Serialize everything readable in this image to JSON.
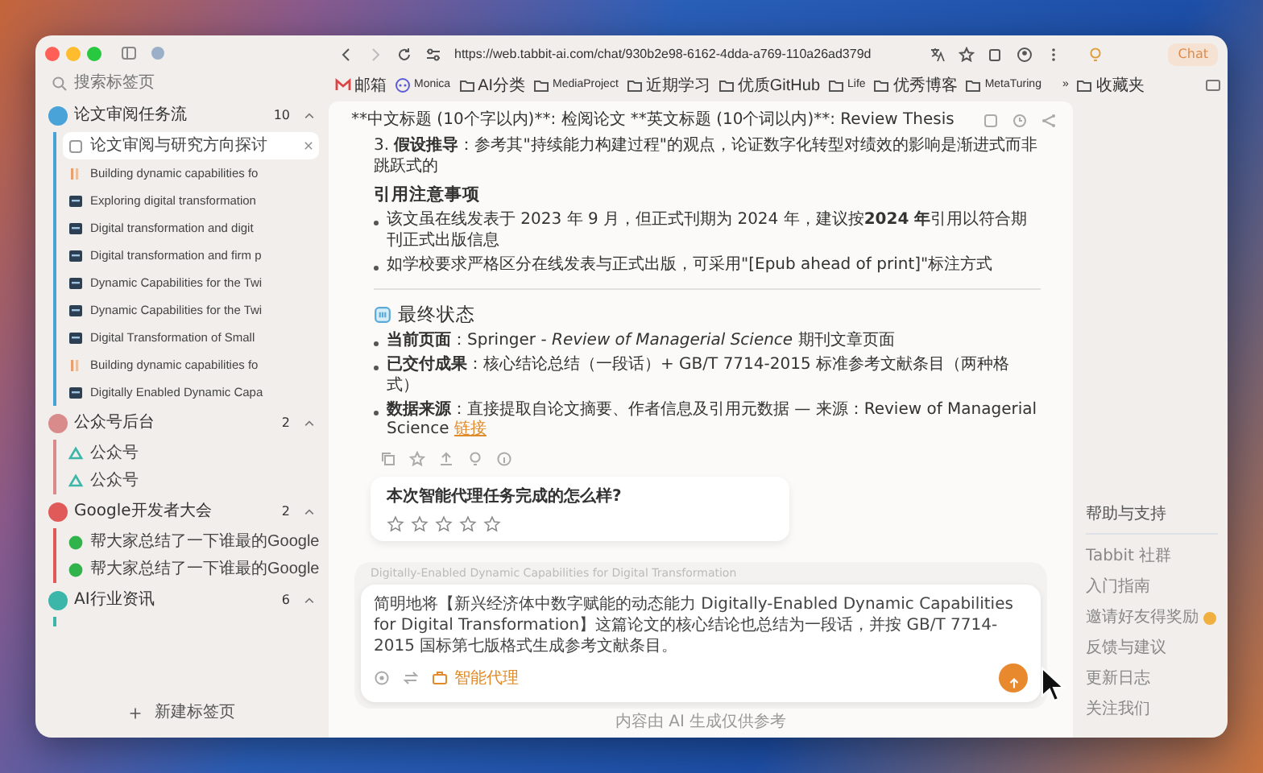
{
  "browser": {
    "url": "https://web.tabbit-ai.com/chat/930b2e98-6162-4dda-a769-110a26ad379d",
    "chat_button": "Chat"
  },
  "bookmarks": [
    {
      "label": "邮箱",
      "kind": "mail"
    },
    {
      "label": "Monica",
      "kind": "app"
    },
    {
      "label": "AI分类",
      "kind": "folder"
    },
    {
      "label": "MediaProject",
      "kind": "folder"
    },
    {
      "label": "近期学习",
      "kind": "folder"
    },
    {
      "label": "优质GitHub",
      "kind": "folder"
    },
    {
      "label": "Life",
      "kind": "folder"
    },
    {
      "label": "优秀博客",
      "kind": "folder"
    },
    {
      "label": "MetaTuring",
      "kind": "folder"
    }
  ],
  "bookmarks_overflow": "»",
  "bookmarks_folder": "收藏夹",
  "sidebar": {
    "search_placeholder": "搜索标签页",
    "groups": [
      {
        "title": "论文审阅任务流",
        "count": "10",
        "expanded": true,
        "color": "#4aa3d8",
        "children": [
          {
            "title": "论文审阅与研究方向探讨",
            "kind": "page",
            "selected": true
          },
          {
            "title": "Building dynamic capabilities fo",
            "kind": "bars",
            "selected": false
          },
          {
            "title": "Exploring digital transformation",
            "kind": "pdf",
            "selected": false
          },
          {
            "title": "Digital transformation and digit",
            "kind": "pdf",
            "selected": false
          },
          {
            "title": "Digital transformation and firm p",
            "kind": "pdf",
            "selected": false
          },
          {
            "title": "Dynamic Capabilities for the Twi",
            "kind": "pdf",
            "selected": false
          },
          {
            "title": "Dynamic Capabilities for the Twi",
            "kind": "pdf",
            "selected": false
          },
          {
            "title": "Digital Transformation of Small",
            "kind": "pdf",
            "selected": false
          },
          {
            "title": "Building dynamic capabilities fo",
            "kind": "bars",
            "selected": false
          },
          {
            "title": "Digitally Enabled Dynamic Capa",
            "kind": "pdf",
            "selected": false
          }
        ]
      },
      {
        "title": "公众号后台",
        "count": "2",
        "expanded": true,
        "color": "#d98a8a",
        "children": [
          {
            "title": "公众号",
            "kind": "wechat",
            "selected": false
          },
          {
            "title": "公众号",
            "kind": "wechat",
            "selected": false
          }
        ]
      },
      {
        "title": "Google开发者大会",
        "count": "2",
        "expanded": true,
        "color": "#e05a5a",
        "children": [
          {
            "title": "帮大家总结了一下谁最的Google",
            "kind": "dot",
            "selected": false
          },
          {
            "title": "帮大家总结了一下谁最的Google",
            "kind": "dot",
            "selected": false
          }
        ]
      },
      {
        "title": "AI行业资讯",
        "count": "6",
        "expanded": true,
        "color": "#3bb6a8"
      }
    ],
    "new_tab": "新建标签页"
  },
  "chat": {
    "title": "**中文标题 (10个字以内)**: 检阅论文 **英文标题 (10个词以内)**: Review Thesis",
    "blocks": [
      {
        "kind": "paragraph",
        "text": "3. **假设推导**：参考其\"持续能力构建过程\"的观点，论证数字化转型对绩效的影响是渐进式而非跳跃式的"
      },
      {
        "kind": "heading",
        "text": "引用注意事项"
      },
      {
        "kind": "bullet",
        "text": "该文虽在线发表于 2023 年 9 月，但正式刊期为 2024 年，建议按**2024 年**引用以符合期刊正式出版信息"
      },
      {
        "kind": "bullet",
        "text": "如学校要求严格区分在线发表与正式出版，可采用\"[Epub ahead of print]\"标注方式"
      },
      {
        "kind": "divider"
      },
      {
        "kind": "section",
        "text": "最终状态"
      },
      {
        "kind": "bullet",
        "text": "**当前页面**：Springer - *Review of Managerial Science* 期刊文章页面"
      },
      {
        "kind": "bullet",
        "text": "**已交付成果**：核心结论总结（一段话）+ GB/T 7714-2015 标准参考文献条目（两种格式）"
      },
      {
        "kind": "bullet",
        "text": "**数据来源**：直接提取自论文摘要、作者信息及引用元数据 — 来源：Review of Managerial Science",
        "link": "链接"
      }
    ],
    "rating": {
      "question": "本次智能代理任务完成的怎么样?",
      "stars": 0
    },
    "composer": {
      "context": "Digitally-Enabled Dynamic Capabilities for Digital Transformation",
      "value": "简明地将【新兴经济体中数字赋能的动态能力 Digitally-Enabled Dynamic Capabilities for Digital Transformation】这篇论文的核心结论也总结为一段话，并按 GB/T 7714-2015 国标第七版格式生成参考文献条目。",
      "agent_label": "智能代理"
    },
    "disclaimer": "内容由 AI 生成仅供参考"
  },
  "help_panel": {
    "title": "帮助与支持",
    "links": [
      {
        "label": "Tabbit 社群",
        "badge": false
      },
      {
        "label": "入门指南",
        "badge": false
      },
      {
        "label": "邀请好友得奖励",
        "badge": true
      },
      {
        "label": "反馈与建议",
        "badge": false
      },
      {
        "label": "更新日志",
        "badge": false
      },
      {
        "label": "关注我们",
        "badge": false
      }
    ]
  }
}
